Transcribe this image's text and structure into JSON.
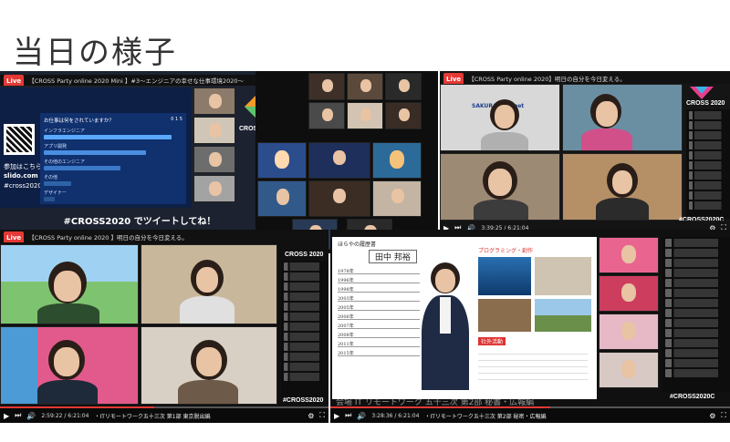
{
  "page": {
    "title": "当日の様子"
  },
  "panel_top_left": {
    "stream_title": "【CROSS Party online 2020 Mini 】#3〜エンジニアの幸せな仕事環境2020〜",
    "live_label": "Live",
    "slido_text": "参加はこちら",
    "slido_url": "slido.com",
    "slido_tag": "#cross2020",
    "poll_question": "お仕事は何をされていますか？",
    "poll_count": "0 1 5",
    "poll_options": [
      "インフラエンジニア",
      "アプリ開発",
      "その他のエンジニア",
      "その他",
      "デザイナー"
    ],
    "poll_values": [
      38,
      31,
      23,
      8,
      3
    ],
    "brand": "CROSS2020",
    "banner": "#CROSS2020 でツイートしてね！"
  },
  "panel_top_middle": {},
  "panel_top_right": {
    "stream_title": "【CROSS Party online 2020】明日の自分を今日変える。",
    "live_label": "Live",
    "sakura_label": "SAKURA internet",
    "brand": "CROSS 2020",
    "time": "3:39:25 / 6:21:04",
    "hashtag": "#CROSS2020C"
  },
  "panel_bottom_left": {
    "stream_title": "【CROSS Party online 2020 】明日の自分を今日変える。",
    "live_label": "Live",
    "time": "2:59:22 / 6:21:04",
    "caption": "・ITリモートワーク五十三次 第1部 東京脱出編",
    "brand": "CROSS 2020",
    "hashtag": "#CROSS2020"
  },
  "panel_bottom_right": {
    "doc_header": "ほらやの履歴書",
    "name": "田中 邦裕",
    "rows": [
      "1978年",
      "1996年",
      "1998年",
      "2003年",
      "2005年",
      "2006年",
      "2007年",
      "2008年",
      "2011年",
      "2015年"
    ],
    "section_label_1": "プログラミング・創作",
    "section_label_2": "社外活動",
    "time": "3:28:36 / 6:21:04",
    "caption": "・ITリモートワーク五十三次 第2部 秘密・広報編",
    "hashtag": "#CROSS2020C",
    "subtitle": "会場 IT リモートワーク 五十三次 第2部 秘書・広報編"
  },
  "colors": {
    "live_red": "#e53935",
    "slido_blue": "#0a2a66",
    "bar_blue": "#5aa9ff",
    "accent_green": "#7fd18a"
  }
}
